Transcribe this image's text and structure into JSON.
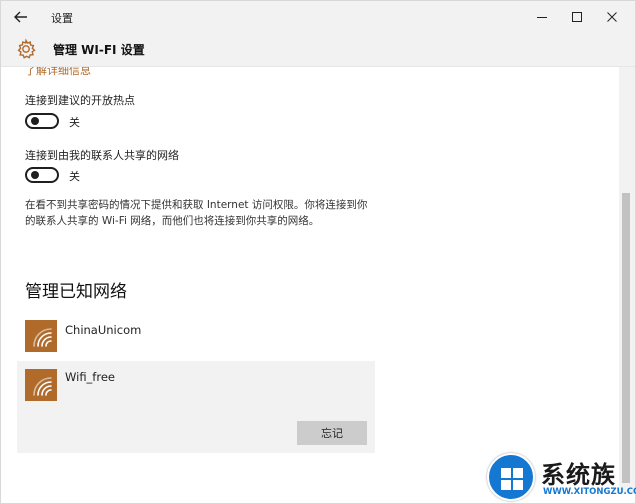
{
  "window": {
    "app_title": "设置",
    "back_icon": "back-arrow-icon",
    "controls": {
      "minimize": "—",
      "maximize": "☐",
      "close": "✕"
    }
  },
  "header": {
    "icon": "gear-icon",
    "title": "管理 WI-FI 设置",
    "accent_color": "#b06a2a"
  },
  "content": {
    "cut_link": "了解详细信息",
    "settings": [
      {
        "label": "连接到建议的开放热点",
        "state": "关"
      },
      {
        "label": "连接到由我的联系人共享的网络",
        "state": "关"
      }
    ],
    "description": "在看不到共享密码的情况下提供和获取 Internet 访问权限。你将连接到你的联系人共享的 Wi-Fi 网络，而他们也将连接到你共享的网络。",
    "section_title": "管理已知网络",
    "networks": [
      {
        "name": "ChinaUnicom",
        "icon": "wifi-icon"
      },
      {
        "name": "Wifi_free",
        "icon": "wifi-icon",
        "selected": true,
        "button": "忘记"
      }
    ]
  },
  "watermark": {
    "title": "系统族",
    "url": "WWW.XITONGZU.COM"
  }
}
